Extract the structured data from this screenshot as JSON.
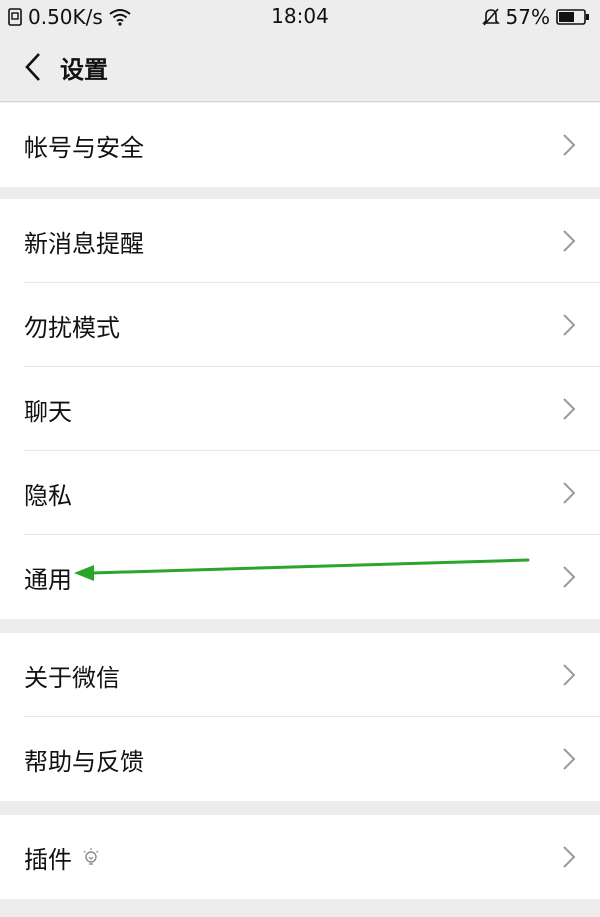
{
  "status_bar": {
    "speed": "0.50K/s",
    "time": "18:04",
    "battery": "57%"
  },
  "nav": {
    "title": "设置"
  },
  "groups": [
    {
      "items": [
        {
          "label": "帐号与安全"
        }
      ]
    },
    {
      "items": [
        {
          "label": "新消息提醒"
        },
        {
          "label": "勿扰模式"
        },
        {
          "label": "聊天"
        },
        {
          "label": "隐私"
        },
        {
          "label": "通用"
        }
      ]
    },
    {
      "items": [
        {
          "label": "关于微信"
        },
        {
          "label": "帮助与反馈"
        }
      ]
    },
    {
      "items": [
        {
          "label": "插件"
        }
      ]
    }
  ],
  "colors": {
    "background": "#ededed",
    "row_background": "#ffffff",
    "annotation_arrow": "#2aa52a"
  },
  "icons": {
    "back": "chevron-left-icon",
    "row": "chevron-right-icon",
    "plugin_extra": "lightbulb-icon"
  }
}
